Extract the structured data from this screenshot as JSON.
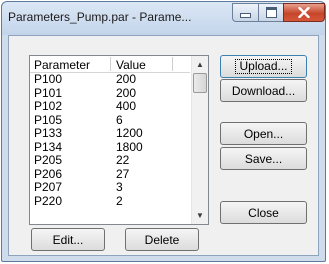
{
  "window": {
    "title": "Parameters_Pump.par - Parame..."
  },
  "list": {
    "headers": {
      "parameter": "Parameter",
      "value": "Value"
    },
    "rows": [
      {
        "parameter": "P100",
        "value": "200"
      },
      {
        "parameter": "P101",
        "value": "200"
      },
      {
        "parameter": "P102",
        "value": "400"
      },
      {
        "parameter": "P105",
        "value": "6"
      },
      {
        "parameter": "P133",
        "value": "1200"
      },
      {
        "parameter": "P134",
        "value": "1800"
      },
      {
        "parameter": "P205",
        "value": "22"
      },
      {
        "parameter": "P206",
        "value": "27"
      },
      {
        "parameter": "P207",
        "value": "3"
      },
      {
        "parameter": "P220",
        "value": "2"
      }
    ]
  },
  "buttons": {
    "upload": "Upload...",
    "download": "Download...",
    "open": "Open...",
    "save": "Save...",
    "close": "Close",
    "edit": "Edit...",
    "delete": "Delete"
  }
}
